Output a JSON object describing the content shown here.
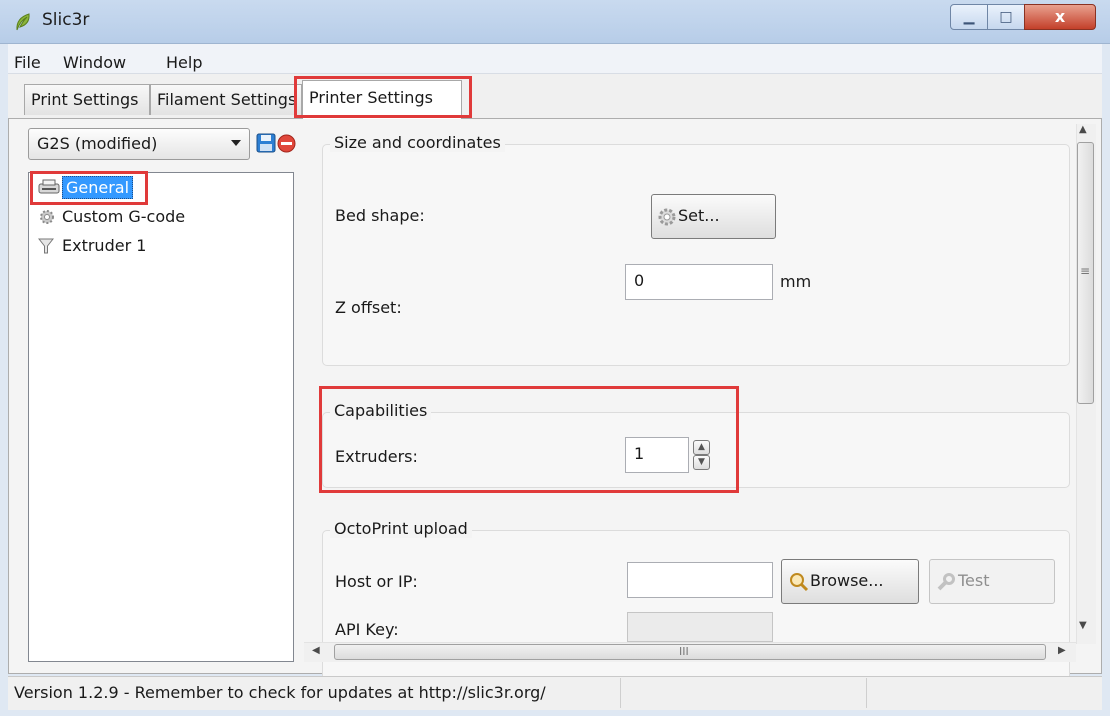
{
  "window": {
    "title": "Slic3r",
    "controls": {
      "minimize": "▁",
      "maximize": "□",
      "close": "x"
    }
  },
  "menu": [
    "File",
    "Window",
    "Help"
  ],
  "tabs": [
    "Print Settings",
    "Filament Settings",
    "Printer Settings"
  ],
  "preset": {
    "selected": "G2S (modified)"
  },
  "tree": {
    "items": [
      {
        "label": "General",
        "icon": "printer-icon"
      },
      {
        "label": "Custom G-code",
        "icon": "gear-icon"
      },
      {
        "label": "Extruder 1",
        "icon": "funnel-icon"
      }
    ]
  },
  "groups": {
    "size": {
      "title": "Size and coordinates",
      "bed_shape_label": "Bed shape:",
      "set_button": "Set...",
      "z_offset_label": "Z offset:",
      "z_offset_value": "0",
      "z_offset_unit": "mm"
    },
    "capabilities": {
      "title": "Capabilities",
      "extruders_label": "Extruders:",
      "extruders_value": "1"
    },
    "octoprint": {
      "title": "OctoPrint upload",
      "host_label": "Host or IP:",
      "host_value": "",
      "browse_button": "Browse...",
      "test_button": "Test",
      "api_key_label": "API Key:"
    }
  },
  "scrollbars": {
    "up": "▲",
    "down": "▼",
    "left": "◀",
    "right": "▶",
    "grip_v": "≡",
    "grip_h": "III"
  },
  "status": {
    "text": "Version 1.2.9 - Remember to check for updates at http://slic3r.org/"
  },
  "colors": {
    "accent": "#3399ff",
    "highlight": "#e03a3a"
  }
}
